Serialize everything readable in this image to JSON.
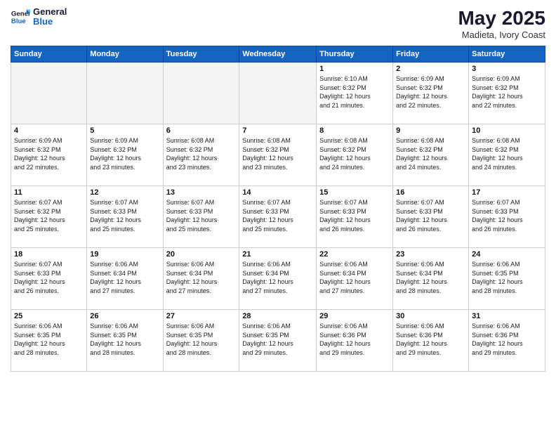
{
  "logo": {
    "line1": "General",
    "line2": "Blue"
  },
  "title": "May 2025",
  "location": "Madieta, Ivory Coast",
  "days_of_week": [
    "Sunday",
    "Monday",
    "Tuesday",
    "Wednesday",
    "Thursday",
    "Friday",
    "Saturday"
  ],
  "weeks": [
    [
      {
        "day": "",
        "text": ""
      },
      {
        "day": "",
        "text": ""
      },
      {
        "day": "",
        "text": ""
      },
      {
        "day": "",
        "text": ""
      },
      {
        "day": "1",
        "text": "Sunrise: 6:10 AM\nSunset: 6:32 PM\nDaylight: 12 hours\nand 21 minutes."
      },
      {
        "day": "2",
        "text": "Sunrise: 6:09 AM\nSunset: 6:32 PM\nDaylight: 12 hours\nand 22 minutes."
      },
      {
        "day": "3",
        "text": "Sunrise: 6:09 AM\nSunset: 6:32 PM\nDaylight: 12 hours\nand 22 minutes."
      }
    ],
    [
      {
        "day": "4",
        "text": "Sunrise: 6:09 AM\nSunset: 6:32 PM\nDaylight: 12 hours\nand 22 minutes."
      },
      {
        "day": "5",
        "text": "Sunrise: 6:09 AM\nSunset: 6:32 PM\nDaylight: 12 hours\nand 23 minutes."
      },
      {
        "day": "6",
        "text": "Sunrise: 6:08 AM\nSunset: 6:32 PM\nDaylight: 12 hours\nand 23 minutes."
      },
      {
        "day": "7",
        "text": "Sunrise: 6:08 AM\nSunset: 6:32 PM\nDaylight: 12 hours\nand 23 minutes."
      },
      {
        "day": "8",
        "text": "Sunrise: 6:08 AM\nSunset: 6:32 PM\nDaylight: 12 hours\nand 24 minutes."
      },
      {
        "day": "9",
        "text": "Sunrise: 6:08 AM\nSunset: 6:32 PM\nDaylight: 12 hours\nand 24 minutes."
      },
      {
        "day": "10",
        "text": "Sunrise: 6:08 AM\nSunset: 6:32 PM\nDaylight: 12 hours\nand 24 minutes."
      }
    ],
    [
      {
        "day": "11",
        "text": "Sunrise: 6:07 AM\nSunset: 6:32 PM\nDaylight: 12 hours\nand 25 minutes."
      },
      {
        "day": "12",
        "text": "Sunrise: 6:07 AM\nSunset: 6:33 PM\nDaylight: 12 hours\nand 25 minutes."
      },
      {
        "day": "13",
        "text": "Sunrise: 6:07 AM\nSunset: 6:33 PM\nDaylight: 12 hours\nand 25 minutes."
      },
      {
        "day": "14",
        "text": "Sunrise: 6:07 AM\nSunset: 6:33 PM\nDaylight: 12 hours\nand 25 minutes."
      },
      {
        "day": "15",
        "text": "Sunrise: 6:07 AM\nSunset: 6:33 PM\nDaylight: 12 hours\nand 26 minutes."
      },
      {
        "day": "16",
        "text": "Sunrise: 6:07 AM\nSunset: 6:33 PM\nDaylight: 12 hours\nand 26 minutes."
      },
      {
        "day": "17",
        "text": "Sunrise: 6:07 AM\nSunset: 6:33 PM\nDaylight: 12 hours\nand 26 minutes."
      }
    ],
    [
      {
        "day": "18",
        "text": "Sunrise: 6:07 AM\nSunset: 6:33 PM\nDaylight: 12 hours\nand 26 minutes."
      },
      {
        "day": "19",
        "text": "Sunrise: 6:06 AM\nSunset: 6:34 PM\nDaylight: 12 hours\nand 27 minutes."
      },
      {
        "day": "20",
        "text": "Sunrise: 6:06 AM\nSunset: 6:34 PM\nDaylight: 12 hours\nand 27 minutes."
      },
      {
        "day": "21",
        "text": "Sunrise: 6:06 AM\nSunset: 6:34 PM\nDaylight: 12 hours\nand 27 minutes."
      },
      {
        "day": "22",
        "text": "Sunrise: 6:06 AM\nSunset: 6:34 PM\nDaylight: 12 hours\nand 27 minutes."
      },
      {
        "day": "23",
        "text": "Sunrise: 6:06 AM\nSunset: 6:34 PM\nDaylight: 12 hours\nand 28 minutes."
      },
      {
        "day": "24",
        "text": "Sunrise: 6:06 AM\nSunset: 6:35 PM\nDaylight: 12 hours\nand 28 minutes."
      }
    ],
    [
      {
        "day": "25",
        "text": "Sunrise: 6:06 AM\nSunset: 6:35 PM\nDaylight: 12 hours\nand 28 minutes."
      },
      {
        "day": "26",
        "text": "Sunrise: 6:06 AM\nSunset: 6:35 PM\nDaylight: 12 hours\nand 28 minutes."
      },
      {
        "day": "27",
        "text": "Sunrise: 6:06 AM\nSunset: 6:35 PM\nDaylight: 12 hours\nand 28 minutes."
      },
      {
        "day": "28",
        "text": "Sunrise: 6:06 AM\nSunset: 6:35 PM\nDaylight: 12 hours\nand 29 minutes."
      },
      {
        "day": "29",
        "text": "Sunrise: 6:06 AM\nSunset: 6:36 PM\nDaylight: 12 hours\nand 29 minutes."
      },
      {
        "day": "30",
        "text": "Sunrise: 6:06 AM\nSunset: 6:36 PM\nDaylight: 12 hours\nand 29 minutes."
      },
      {
        "day": "31",
        "text": "Sunrise: 6:06 AM\nSunset: 6:36 PM\nDaylight: 12 hours\nand 29 minutes."
      }
    ]
  ]
}
